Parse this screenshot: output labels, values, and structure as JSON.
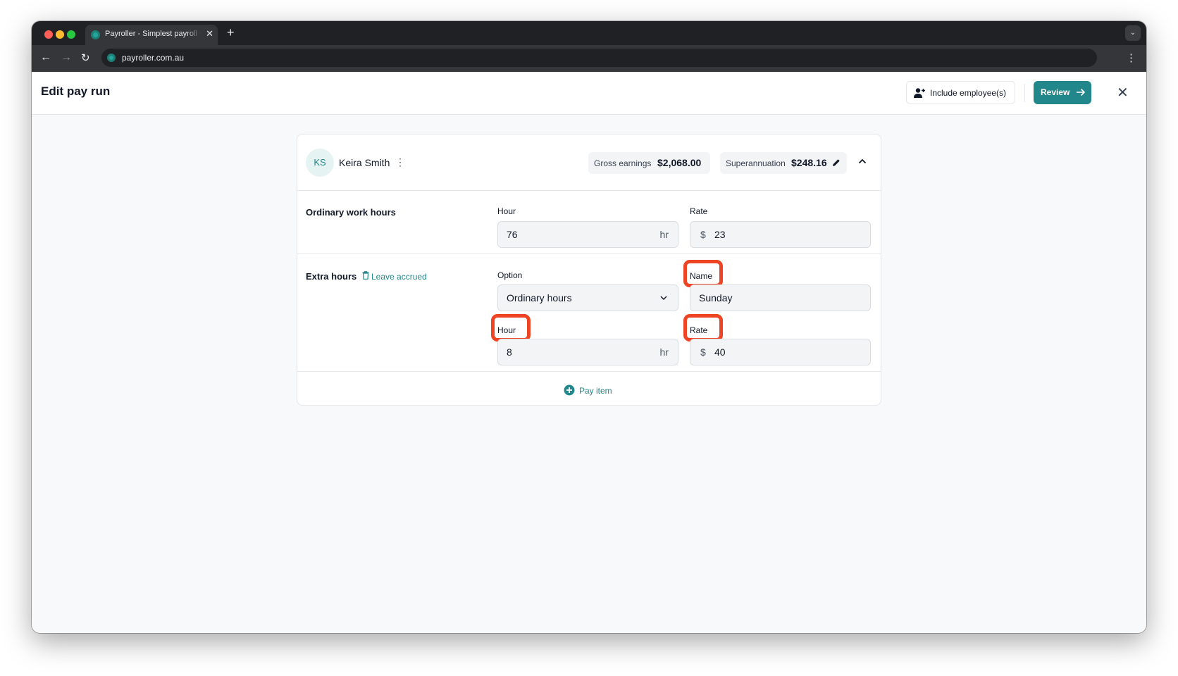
{
  "browser": {
    "tab_title": "Payroller - Simplest payroll software",
    "tab_close": "✕",
    "new_tab": "+",
    "url": "payroller.com.au"
  },
  "header": {
    "title": "Edit pay run",
    "include_label": "Include employee(s)",
    "review_label": "Review"
  },
  "employee": {
    "initials": "KS",
    "name": "Keira Smith",
    "gross_label": "Gross earnings",
    "gross_value": "$2,068.00",
    "super_label": "Superannuation",
    "super_value": "$248.16"
  },
  "ordinary": {
    "title": "Ordinary work hours",
    "hour_label": "Hour",
    "hour_value": "76",
    "hour_unit": "hr",
    "rate_label": "Rate",
    "rate_prefix": "$",
    "rate_value": "23"
  },
  "extra": {
    "title": "Extra hours",
    "leave_link": "Leave accrued",
    "option_label": "Option",
    "option_value": "Ordinary hours",
    "name_label": "Name",
    "name_value": "Sunday",
    "hour_label": "Hour",
    "hour_value": "8",
    "hour_unit": "hr",
    "rate_label": "Rate",
    "rate_prefix": "$",
    "rate_value": "40"
  },
  "pay_item_label": "Pay item",
  "colors": {
    "accent": "#21878a",
    "highlight": "#ee4423"
  }
}
